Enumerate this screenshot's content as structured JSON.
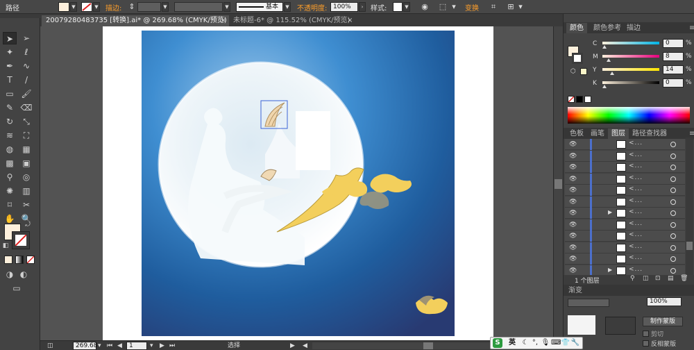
{
  "control_bar": {
    "title": "路径",
    "stroke_label": "描边:",
    "stroke_profile_label": "基本",
    "opacity_label": "不透明度:",
    "opacity_value": "100%",
    "style_label": "样式:",
    "transform_label": "变换",
    "fill_color": "#fdf0dc",
    "accent_color": "#ff9f2a"
  },
  "tools": {
    "names": [
      "selection-tool-icon",
      "direct-selection-tool-icon",
      "magic-wand-icon",
      "lasso-icon",
      "pen-tool-icon",
      "curvature-icon",
      "type-tool-icon",
      "line-tool-icon",
      "rectangle-tool-icon",
      "paintbrush-icon",
      "pencil-icon",
      "eraser-icon",
      "rotate-tool-icon",
      "scale-tool-icon",
      "warp-tool-icon",
      "free-transform-icon",
      "shape-builder-icon",
      "perspective-grid-icon",
      "mesh-tool-icon",
      "gradient-tool-icon",
      "eyedropper-icon",
      "blend-tool-icon",
      "symbol-sprayer-icon",
      "graph-tool-icon",
      "artboard-tool-icon",
      "slice-tool-icon",
      "hand-tool-icon",
      "zoom-tool-icon"
    ],
    "fill_swatch": "#fdf0dc"
  },
  "documents": {
    "tabs": [
      {
        "label": "20079280483735 [转换].ai* @ 269.68% (CMYK/预览)",
        "active": true
      },
      {
        "label": "未标题-6* @ 115.52% (CMYK/预览)",
        "active": false
      }
    ]
  },
  "status_bar": {
    "zoom": "269.68",
    "artboard": "1",
    "tool_label": "选择"
  },
  "color_panel": {
    "tabs": [
      "颜色",
      "颜色参考",
      "描边"
    ],
    "channels": [
      {
        "label": "C",
        "value": "0",
        "level": 0
      },
      {
        "label": "M",
        "value": "8",
        "level": 8
      },
      {
        "label": "Y",
        "value": "14",
        "level": 14
      },
      {
        "label": "K",
        "value": "0",
        "level": 0
      }
    ],
    "unit": "%",
    "current_color": "#fdf0dc"
  },
  "layers_panel": {
    "tabs": [
      "色板",
      "画笔",
      "图层",
      "路径查找器"
    ],
    "row_name": "<...",
    "row_count": 12,
    "summary": "1 个图层"
  },
  "transparency_panel": {
    "tab_partial": "渐变",
    "opacity_partial": "100%",
    "make_mask_button": "制作蒙版",
    "invert_mask_label": "反相蒙版",
    "clip_label": "剪切"
  },
  "taskbar": {
    "ime_label": "英"
  }
}
